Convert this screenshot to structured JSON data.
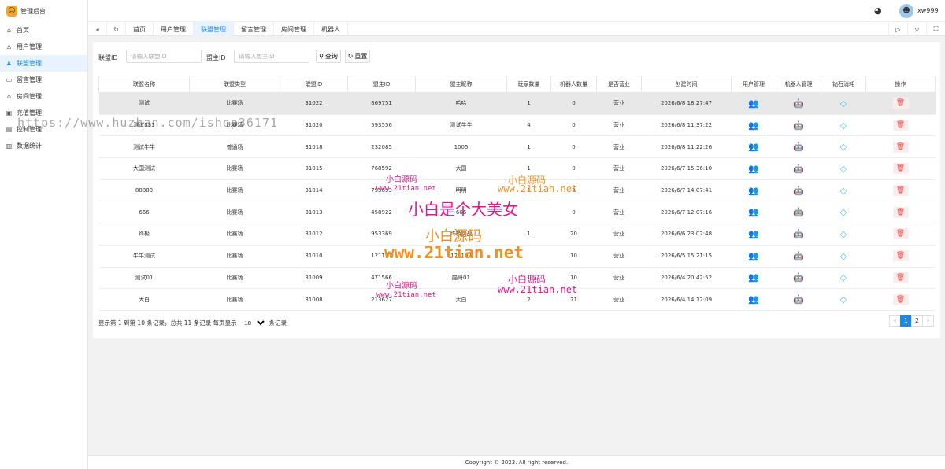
{
  "app": {
    "title": "管理后台",
    "username": "xw999"
  },
  "sidebar": {
    "items": [
      {
        "label": "首页",
        "icon": "home-icon"
      },
      {
        "label": "用户管理",
        "icon": "user-icon"
      },
      {
        "label": "联盟管理",
        "icon": "users-icon",
        "active": true
      },
      {
        "label": "留言管理",
        "icon": "message-icon"
      },
      {
        "label": "房间管理",
        "icon": "house-icon"
      },
      {
        "label": "充值管理",
        "icon": "recharge-icon"
      },
      {
        "label": "控制管理",
        "icon": "control-icon"
      },
      {
        "label": "数据统计",
        "icon": "stats-icon"
      }
    ]
  },
  "tabs": [
    "首页",
    "用户管理",
    "联盟管理",
    "留言管理",
    "房间管理",
    "机器人"
  ],
  "filter": {
    "union_label": "联盟ID",
    "union_placeholder": "请输入联盟ID",
    "owner_label": "盟主ID",
    "owner_placeholder": "请输入盟主ID",
    "search_label": "查询",
    "reset_label": "重置"
  },
  "table": {
    "columns": [
      "联盟名称",
      "联盟类型",
      "联盟ID",
      "盟主ID",
      "盟主昵称",
      "玩家数量",
      "机器人数量",
      "是否营业",
      "创建时间",
      "用户管理",
      "机器人管理",
      "钻石消耗",
      "操作"
    ],
    "rows": [
      [
        "测试",
        "比赛场",
        "31022",
        "869751",
        "哈哈",
        "1",
        "0",
        "营业",
        "2026/6/8 18:27:47"
      ],
      [
        "测试333",
        "比赛场",
        "31020",
        "593556",
        "测试牛牛",
        "4",
        "0",
        "营业",
        "2026/6/8 11:37:22"
      ],
      [
        "测试牛牛",
        "普通场",
        "31018",
        "232085",
        "1005",
        "1",
        "0",
        "营业",
        "2026/6/8 11:22:26"
      ],
      [
        "大国测试",
        "比赛场",
        "31015",
        "768592",
        "大国",
        "1",
        "0",
        "营业",
        "2026/6/7 15:36:10"
      ],
      [
        "88888",
        "比赛场",
        "31014",
        "793693",
        "明明",
        "1",
        "8",
        "营业",
        "2026/6/7 14:07:41"
      ],
      [
        "666",
        "比赛场",
        "31013",
        "458922",
        "666",
        "",
        "0",
        "营业",
        "2026/6/7 12:07:16"
      ],
      [
        "终极",
        "比赛场",
        "31012",
        "953369",
        "终极挑战",
        "1",
        "20",
        "营业",
        "2026/6/6 23:02:48"
      ],
      [
        "牛牛测试",
        "比赛场",
        "31010",
        "121197",
        "121197",
        "",
        "10",
        "营业",
        "2026/6/5 15:21:15"
      ],
      [
        "测试01",
        "比赛场",
        "31009",
        "471566",
        "酷哥01",
        "1",
        "10",
        "营业",
        "2026/6/4 20:42:52"
      ],
      [
        "大白",
        "比赛场",
        "31008",
        "213627",
        "大白",
        "2",
        "71",
        "营业",
        "2026/6/4 14:12:09"
      ]
    ]
  },
  "pagination": {
    "info_prefix": "显示第 1 到第 10 条记录，总共 11 条记录  每页显示",
    "page_size": "10",
    "info_suffix": "条记录",
    "pages": [
      "1",
      "2"
    ],
    "prev": "‹",
    "next": "›"
  },
  "footer": "Copyright © 2023. All right reserved.",
  "watermarks": {
    "url": "https://www.huzhan.com/ishop36171",
    "cn1": "小白源码",
    "domain_small": "www.21tian.net",
    "cn2": "小白源码",
    "slogan": "小白是个大美女",
    "cn3": "小白源码",
    "domain_big": "www.21tian.net",
    "cn4": "小白源码",
    "cn5": "小白源码"
  }
}
